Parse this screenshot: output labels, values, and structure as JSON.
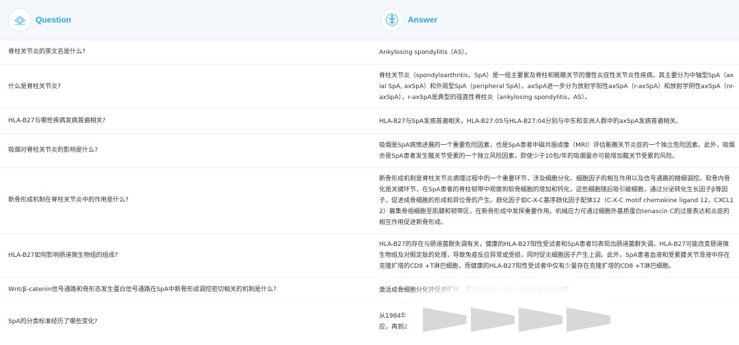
{
  "header": {
    "question_label": "Question",
    "answer_label": "Answer",
    "question_icon": "chat-bubble-icon",
    "answer_icon": "brain-circuit-icon"
  },
  "rows": [
    {
      "question": "脊柱关节炎的英文名是什么?",
      "answer": "Ankylosing spondylitis（AS）。"
    },
    {
      "question": "什么是脊柱关节炎?",
      "answer": "脊柱关节炎（spondyloarthritis，SpA）是一组主要累及脊柱和骶髂关节的慢性炎症性关节炎性疾病。其主要分为中轴型SpA（axial SpA, axSpA）和外周型SpA（peripheral SpA）。axSpA进一步分为放射学阳性axSpA（r-axSpA）和放射学阴性axSpA（nr-axSpA），r-axSpA是典型的强直性脊柱炎（ankylosing spondylitis，AS）。"
    },
    {
      "question": "HLA-B27与哪些疾病发病普遍相关?",
      "answer": "HLA-B27与SpA发病普遍相关，HLA-B27:05与HLA-B27:04分别与中东和亚洲人群中的axSpA发病普遍相关。"
    },
    {
      "question": "吸烟对脊柱关节炎的影响是什么?",
      "answer": "吸烟是SpA病情进展的一个重要危险因素，也是SpA患者中磁共振成像（MRI）评估骶髂关节炎症的一个独立危险因素。此外，吸烟亦是SpA患者发生髋关节受累的一个独立风险因素，即使少于10包/年的吸烟量亦可能增加髋关节受累的风险。"
    },
    {
      "question": "新骨形成机制在脊柱关节炎中的作用是什么?",
      "answer": "新骨形成机制是脊柱关节炎病理过程中的一个重要环节，涉及细胞分化、细胞因子的相互作用以及信号通路的精细调控。软骨内骨化是关键环节，在SpA患者的脊柱韧带中观察到软骨细胞的增加和钙化，这些细胞随后吸引破细胞，通过分泌转化生长因子β等因子，促进成骨细胞的形成和异位骨的产生。趋化因子如C-X-C基序趋化因子配体12（C-X-C motif chemokine ligand 12，CXCL12）募集骨祖细胞至肌腱和韧带区，在新骨形成中发挥重要作用。机械应力可通过细胞外基质蛋白tenascin C的过度表达和炎症的相互作用促进新骨形成。"
    },
    {
      "question": "HLA-B27如何影响肠道微生物组的组成?",
      "answer": "HLA-B27的存在与肠道菌群失调有关，健康的HLA-B27阳性受试者和SpA患者均表现出肠道菌群失调。HLA-B27可能改变肠道微生物组及对假定肽的处理，导致免疫反应异常或受损，同时促炎细胞因子产生上调。此外，SpA患者血液和受累膝关节滑液中存在克隆扩增的CD8 +T淋巴细胞，而健康的HLA-B27阳性受试者中仅有少量存在克隆扩增的CD8 +T淋巴细胞。"
    },
    {
      "question": "Wnt/β-catenin信号通路和骨形态发生蛋白信号通路在SpA中新骨形成调控密切相关的机制是什么?",
      "answer": "激活成骨细胞分化并促进矿化，通过转化因子β信号通路促进成骨作用"
    },
    {
      "question": "SpA的分类标准经历了哪些变化?",
      "answer": "从1984年\n应，再到2"
    }
  ]
}
